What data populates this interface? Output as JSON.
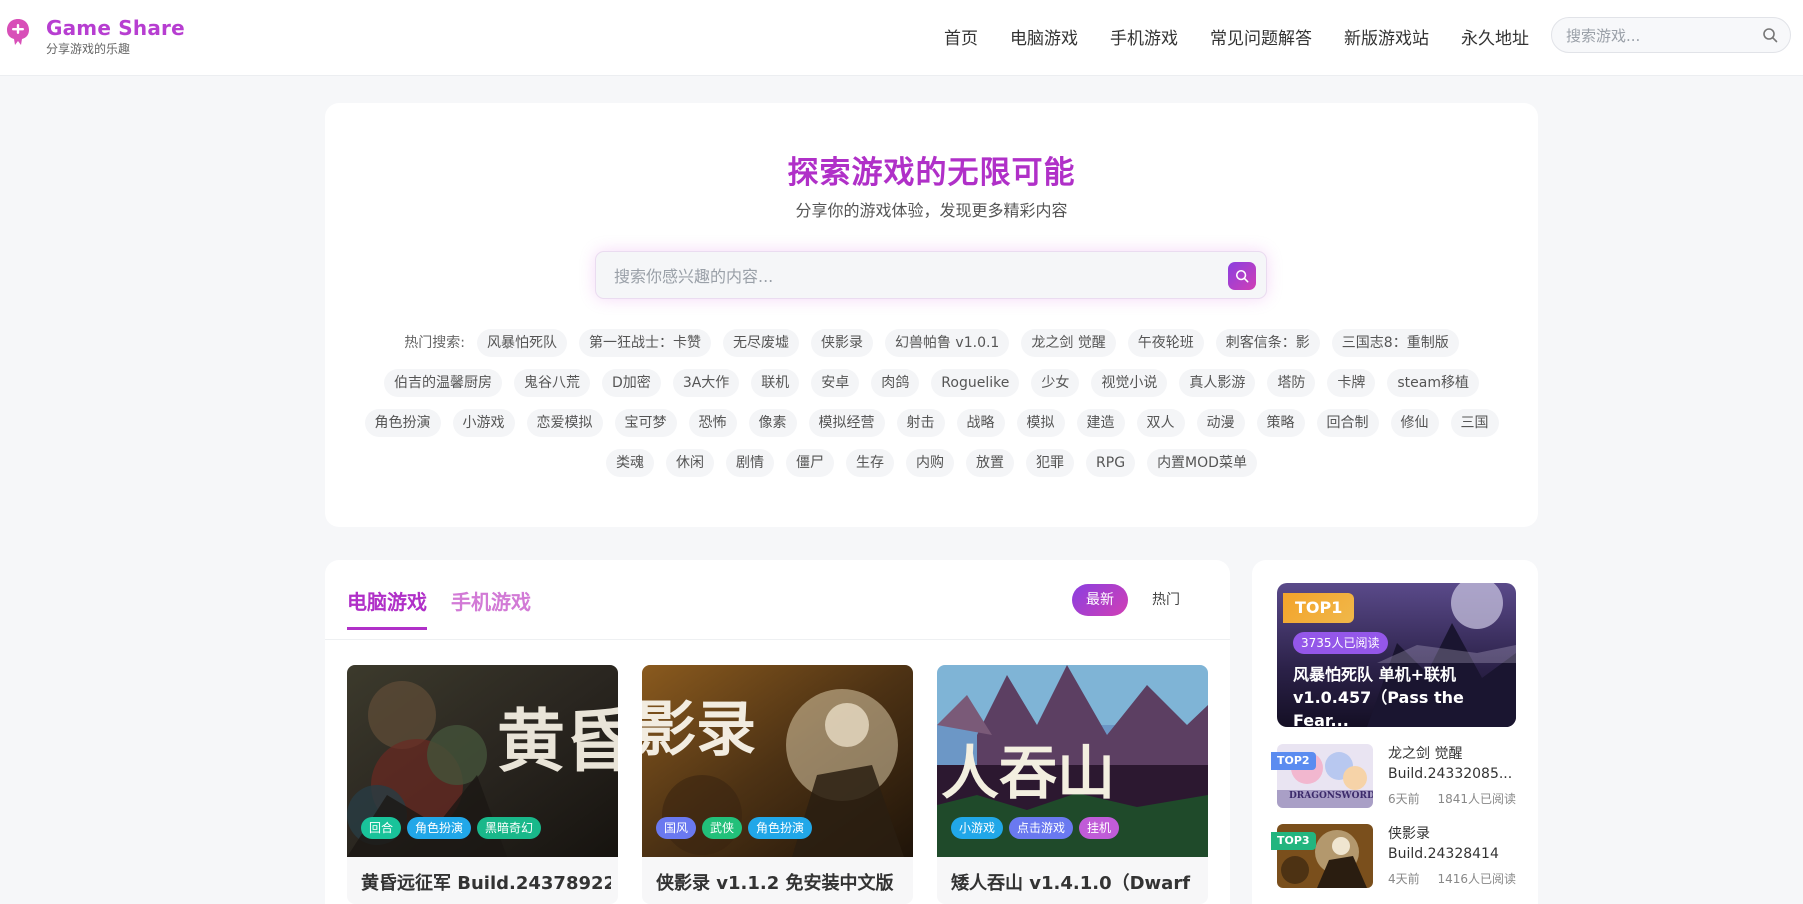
{
  "header": {
    "brand": "Game Share",
    "slogan": "分享游戏的乐趣",
    "nav": [
      "首页",
      "电脑游戏",
      "手机游戏",
      "常见问题解答",
      "新版游戏站",
      "永久地址"
    ],
    "search_placeholder": "搜索游戏..."
  },
  "hero": {
    "title": "探索游戏的无限可能",
    "subtitle": "分享你的游戏体验，发现更多精彩内容",
    "search_placeholder": "搜索你感兴趣的内容...",
    "hot_label": "热门搜索:",
    "tags": [
      "风暴怕死队",
      "第一狂战士：卡赞",
      "无尽废墟",
      "侠影录",
      "幻兽帕鲁 v1.0.1",
      "龙之剑 觉醒",
      "午夜轮班",
      "刺客信条：影",
      "三国志8：重制版",
      "伯吉的温馨厨房",
      "鬼谷八荒",
      "D加密",
      "3A大作",
      "联机",
      "安卓",
      "肉鸽",
      "Roguelike",
      "少女",
      "视觉小说",
      "真人影游",
      "塔防",
      "卡牌",
      "steam移植",
      "角色扮演",
      "小游戏",
      "恋爱模拟",
      "宝可梦",
      "恐怖",
      "像素",
      "模拟经营",
      "射击",
      "战略",
      "模拟",
      "建造",
      "双人",
      "动漫",
      "策略",
      "回合制",
      "修仙",
      "三国",
      "类魂",
      "休闲",
      "剧情",
      "僵尸",
      "生存",
      "内购",
      "放置",
      "犯罪",
      "RPG",
      "内置MOD菜单"
    ]
  },
  "main": {
    "tabs": [
      "电脑游戏",
      "手机游戏"
    ],
    "sort": [
      "最新",
      "热门"
    ],
    "cards": [
      {
        "title": "黄昏远征军 Build.24378922",
        "art_text": "黄昏",
        "tags": [
          {
            "label": "回合",
            "color": "#19c39a"
          },
          {
            "label": "角色扮演",
            "color": "#21a7e8"
          },
          {
            "label": "黑暗奇幻",
            "color": "#19b88a"
          }
        ]
      },
      {
        "title": "侠影录 v1.1.2 免安装中文版",
        "art_text": "影录",
        "tags": [
          {
            "label": "国风",
            "color": "#6a79f0"
          },
          {
            "label": "武侠",
            "color": "#22c07a"
          },
          {
            "label": "角色扮演",
            "color": "#21a7e8"
          }
        ]
      },
      {
        "title": "矮人吞山 v1.4.1.0（Dwarf",
        "art_text": "人吞山",
        "tags": [
          {
            "label": "小游戏",
            "color": "#21a7e8"
          },
          {
            "label": "点击游戏",
            "color": "#6a79f0"
          },
          {
            "label": "挂机",
            "color": "#c05cd8"
          }
        ]
      }
    ]
  },
  "ranking": {
    "top1": {
      "badge": "TOP1",
      "reads": "3735人已阅读",
      "title": "风暴怕死队 单机+联机 v1.0.457（Pass the Fear..."
    },
    "items": [
      {
        "badge": "TOP2",
        "badge_color": "#5b8cf0",
        "title": "龙之剑 觉醒 Build.24332085...",
        "time": "6天前",
        "reads": "1841人已阅读",
        "thumb_text": "DRAGONSWORD"
      },
      {
        "badge": "TOP3",
        "badge_color": "#22b57f",
        "title": "侠影录 Build.24328414 ...",
        "time": "4天前",
        "reads": "1416人已阅读",
        "thumb_text": ""
      }
    ]
  },
  "colors": {
    "accent": "#b030c8",
    "accent_light": "#d27ad6",
    "gradient_start": "#8a3fe0",
    "gradient_end": "#d13fb5"
  }
}
